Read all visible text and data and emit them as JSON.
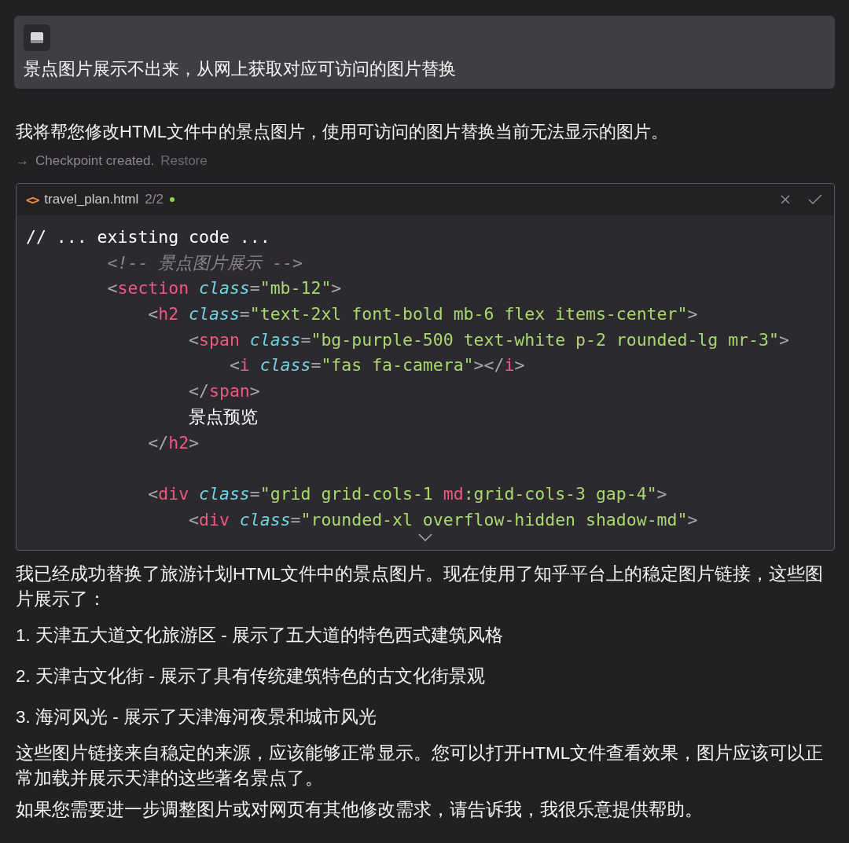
{
  "user_message": {
    "text": "景点图片展示不出来，从网上获取对应可访问的图片替换"
  },
  "intro": "我将帮您修改HTML文件中的景点图片，使用可访问的图片替换当前无法显示的图片。",
  "checkpoint": {
    "arrow": "→",
    "label": "Checkpoint created.",
    "action": "Restore"
  },
  "code_block": {
    "icon": "<>",
    "filename": "travel_plan.html",
    "counter": "2/2",
    "modified": true,
    "lines": [
      {
        "kind": "code",
        "tokens": [
          {
            "kind": "plain",
            "text": "// ... existing code ..."
          }
        ]
      },
      {
        "kind": "code",
        "tokens": [
          {
            "kind": "comment",
            "text": "        <!-- 景点图片展示 -->"
          }
        ]
      },
      {
        "kind": "code",
        "tokens": [
          {
            "kind": "punct",
            "text": "        <"
          },
          {
            "kind": "tag",
            "text": "section"
          },
          {
            "kind": "attr",
            "text": " class"
          },
          {
            "kind": "punct",
            "text": "="
          },
          {
            "kind": "string",
            "text": "\"mb-12\""
          },
          {
            "kind": "punct",
            "text": ">"
          }
        ]
      },
      {
        "kind": "code",
        "tokens": [
          {
            "kind": "punct",
            "text": "            <"
          },
          {
            "kind": "tag",
            "text": "h2"
          },
          {
            "kind": "attr",
            "text": " class"
          },
          {
            "kind": "punct",
            "text": "="
          },
          {
            "kind": "string",
            "text": "\"text-2xl font-bold mb-6 flex items-center\""
          },
          {
            "kind": "punct",
            "text": ">"
          }
        ]
      },
      {
        "kind": "code",
        "tokens": [
          {
            "kind": "punct",
            "text": "                <"
          },
          {
            "kind": "tag",
            "text": "span"
          },
          {
            "kind": "attr",
            "text": " class"
          },
          {
            "kind": "punct",
            "text": "="
          },
          {
            "kind": "string",
            "text": "\"bg-purple-500 text-white p-2 rounded-lg mr-3\""
          },
          {
            "kind": "punct",
            "text": ">"
          }
        ]
      },
      {
        "kind": "code",
        "tokens": [
          {
            "kind": "punct",
            "text": "                    <"
          },
          {
            "kind": "tag",
            "text": "i"
          },
          {
            "kind": "attr",
            "text": " class"
          },
          {
            "kind": "punct",
            "text": "="
          },
          {
            "kind": "string",
            "text": "\"fas fa-camera\""
          },
          {
            "kind": "punct",
            "text": "></"
          },
          {
            "kind": "tag",
            "text": "i"
          },
          {
            "kind": "punct",
            "text": ">"
          }
        ]
      },
      {
        "kind": "code",
        "tokens": [
          {
            "kind": "punct",
            "text": "                </"
          },
          {
            "kind": "tag",
            "text": "span"
          },
          {
            "kind": "punct",
            "text": ">"
          }
        ]
      },
      {
        "kind": "code",
        "tokens": [
          {
            "kind": "plain",
            "text": "                景点预览"
          }
        ]
      },
      {
        "kind": "code",
        "tokens": [
          {
            "kind": "punct",
            "text": "            </"
          },
          {
            "kind": "tag",
            "text": "h2"
          },
          {
            "kind": "punct",
            "text": ">"
          }
        ]
      },
      {
        "kind": "blank"
      },
      {
        "kind": "code",
        "tokens": [
          {
            "kind": "punct",
            "text": "            <"
          },
          {
            "kind": "tag",
            "text": "div"
          },
          {
            "kind": "attr",
            "text": " class"
          },
          {
            "kind": "punct",
            "text": "="
          },
          {
            "kind": "string",
            "text": "\"grid grid-cols-1 "
          },
          {
            "kind": "tag",
            "text": "md"
          },
          {
            "kind": "string",
            "text": ":grid-cols-3 gap-4\""
          },
          {
            "kind": "punct",
            "text": ">"
          }
        ]
      },
      {
        "kind": "code",
        "tokens": [
          {
            "kind": "punct",
            "text": "                <"
          },
          {
            "kind": "tag",
            "text": "div"
          },
          {
            "kind": "attr",
            "text": " class"
          },
          {
            "kind": "punct",
            "text": "="
          },
          {
            "kind": "string",
            "text": "\"rounded-xl overflow-hidden shadow-md\""
          },
          {
            "kind": "punct",
            "text": ">"
          }
        ]
      }
    ]
  },
  "response": [
    {
      "kind": "paragraph",
      "text": "我已经成功替换了旅游计划HTML文件中的景点图片。现在使用了知乎平台上的稳定图片链接，这些图片展示了："
    },
    {
      "kind": "item",
      "text": "1. 天津五大道文化旅游区 - 展示了五大道的特色西式建筑风格"
    },
    {
      "kind": "item",
      "text": "2. 天津古文化街 - 展示了具有传统建筑特色的古文化街景观"
    },
    {
      "kind": "item",
      "text": "3. 海河风光 - 展示了天津海河夜景和城市风光"
    },
    {
      "kind": "paragraph",
      "text": "这些图片链接来自稳定的来源，应该能够正常显示。您可以打开HTML文件查看效果，图片应该可以正常加载并展示天津的这些著名景点了。"
    },
    {
      "kind": "paragraph",
      "text": "如果您需要进一步调整图片或对网页有其他修改需求，请告诉我，我很乐意提供帮助。"
    }
  ]
}
